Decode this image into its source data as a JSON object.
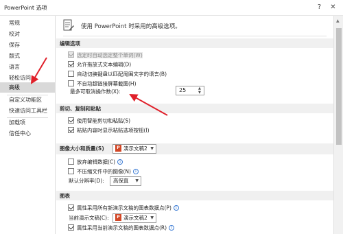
{
  "window": {
    "title": "PowerPoint 选项",
    "help_icon": "?",
    "close_icon": "✕"
  },
  "sidebar": {
    "items": [
      {
        "label": "常规"
      },
      {
        "label": "校对"
      },
      {
        "label": "保存"
      },
      {
        "label": "版式"
      },
      {
        "label": "语言"
      },
      {
        "label": "轻松访问"
      },
      {
        "label": "高级",
        "active": true
      },
      {
        "label": "自定义功能区"
      },
      {
        "label": "快速访问工具栏"
      },
      {
        "label": "加载项"
      },
      {
        "label": "信任中心"
      }
    ]
  },
  "header": {
    "text": "使用 PowerPoint 时采用的高级选项。"
  },
  "sections": {
    "editing": "编辑选项",
    "clipboard": "剪切、复制和粘贴",
    "image_size": "图像大小和质量(S)",
    "chart": "图表"
  },
  "editing": {
    "select_word": "选定时自动选定整个单词(W)",
    "drag_drop": "允许拖放式文本编辑(D)",
    "auto_keyboard": "自动切换键盘以匹配周围文字的语言(B)",
    "no_hyperlink": "不自动超链接屏幕截图(H)",
    "undo_label": "最多可取消操作数(X):",
    "undo_value": "25"
  },
  "clipboard": {
    "smart_cut": "使用智能剪切和粘贴(S)",
    "paste_options": "粘贴内容时显示粘贴选项按钮(I)"
  },
  "image": {
    "doc_name": "演示文稿2",
    "discard_data": "放弃编辑数据(C)",
    "no_compress": "不压缩文件中的图像(N)",
    "resolution_label": "默认分辨率(D):",
    "resolution_value": "高保真"
  },
  "chart": {
    "all_new": "属性采用所有新演示文稿的图表数据点(P)",
    "current_label": "当前演示文稿(C):",
    "doc_name": "演示文稿2",
    "current_doc": "属性采用当前演示文稿的图表数据点(R)"
  },
  "annotations": {
    "arrow_color": "#e0202a"
  }
}
